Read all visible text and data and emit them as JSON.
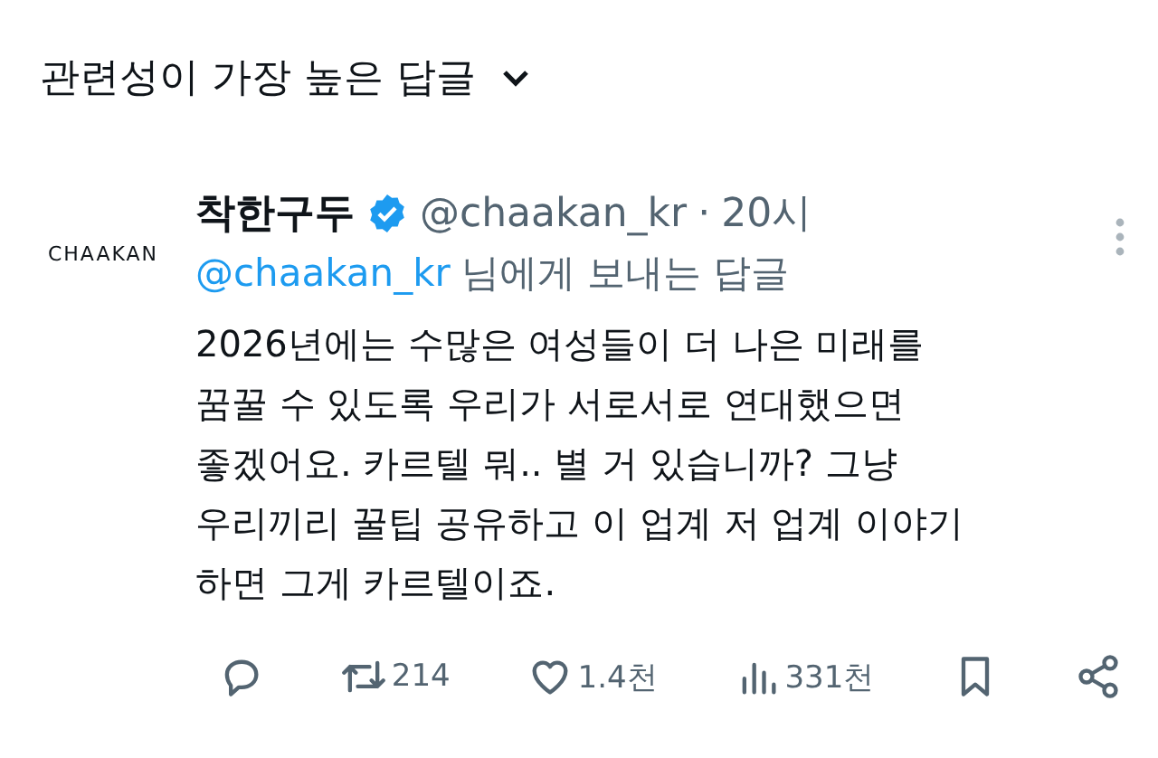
{
  "section_header": {
    "title": "관련성이 가장 높은 답글"
  },
  "reply": {
    "avatar_text": "CHAAKAN",
    "display_name": "착한구두",
    "verified": true,
    "handle": "@chaakan_kr",
    "separator": "·",
    "time": "20시",
    "replying_to": {
      "mention": "@chaakan_kr",
      "suffix": "님에게 보내는 답글"
    },
    "body_lines": [
      "2026년에는 수많은 여성들이 더 나은 미래를",
      "꿈꿀 수 있도록 우리가 서로서로 연대했으면",
      "좋겠어요. 카르텔 뭐.. 별 거 있습니까? 그냥",
      "우리끼리 꿀팁 공유하고 이 업계 저 업계 이야기",
      "하면 그게 카르텔이죠."
    ],
    "actions": [
      {
        "kind": "reply"
      },
      {
        "kind": "retweet",
        "count": "214"
      },
      {
        "kind": "like",
        "count": "1.4천"
      },
      {
        "kind": "views",
        "count": "331천"
      },
      {
        "kind": "bookmark"
      },
      {
        "kind": "share"
      }
    ]
  }
}
